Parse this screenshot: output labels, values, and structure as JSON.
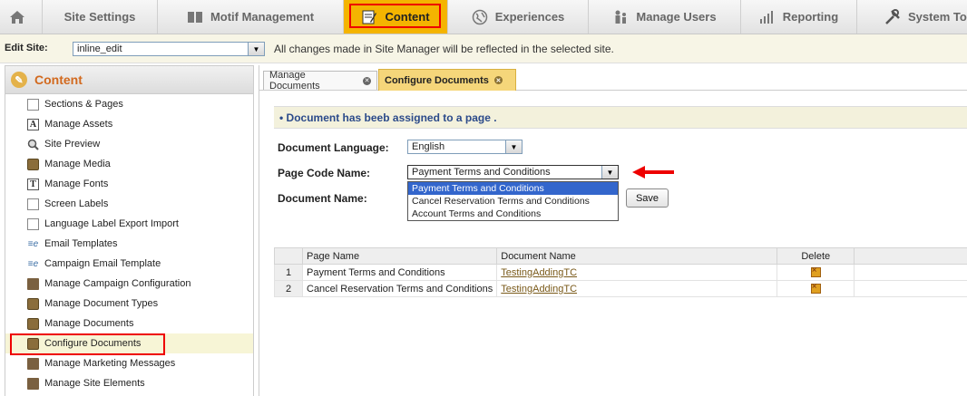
{
  "nav": {
    "items": [
      {
        "key": "home",
        "label": ""
      },
      {
        "key": "site",
        "label": "Site Settings"
      },
      {
        "key": "motif",
        "label": "Motif Management"
      },
      {
        "key": "content",
        "label": "Content"
      },
      {
        "key": "experiences",
        "label": "Experiences"
      },
      {
        "key": "users",
        "label": "Manage Users"
      },
      {
        "key": "reporting",
        "label": "Reporting"
      },
      {
        "key": "system",
        "label": "System To"
      }
    ],
    "active": "content"
  },
  "edit_site": {
    "label": "Edit Site:",
    "value": "inline_edit",
    "note": "All changes made in Site Manager will be reflected in the selected site."
  },
  "sidebar": {
    "title": "Content",
    "items": [
      {
        "label": "Sections & Pages",
        "icon": "page-icon"
      },
      {
        "label": "Manage Assets",
        "icon": "assets-icon"
      },
      {
        "label": "Site Preview",
        "icon": "magnifier-icon"
      },
      {
        "label": "Manage Media",
        "icon": "media-icon"
      },
      {
        "label": "Manage Fonts",
        "icon": "font-icon"
      },
      {
        "label": "Screen Labels",
        "icon": "page-icon"
      },
      {
        "label": "Language Label Export Import",
        "icon": "page-icon"
      },
      {
        "label": "Email Templates",
        "icon": "email-template-icon"
      },
      {
        "label": "Campaign Email Template",
        "icon": "email-template-icon"
      },
      {
        "label": "Manage Campaign Configuration",
        "icon": "document-icon"
      },
      {
        "label": "Manage Document Types",
        "icon": "document-icon"
      },
      {
        "label": "Manage Documents",
        "icon": "document-icon"
      },
      {
        "label": "Configure Documents",
        "icon": "document-icon"
      },
      {
        "label": "Manage Marketing Messages",
        "icon": "document-icon"
      },
      {
        "label": "Manage Site Elements",
        "icon": "document-icon"
      }
    ],
    "active_index": 12
  },
  "tabs": [
    {
      "label": "Manage Documents"
    },
    {
      "label": "Configure Documents"
    }
  ],
  "message": "• Document has beeb assigned to a page .",
  "form": {
    "language_label": "Document Language:",
    "language_value": "English",
    "page_code_label": "Page Code Name:",
    "page_code_value": "Payment Terms and Conditions",
    "page_code_options": [
      "Payment Terms and Conditions",
      "Cancel Reservation Terms and Conditions",
      "Account Terms and Conditions"
    ],
    "document_name_label": "Document Name:",
    "save_label": "Save"
  },
  "table": {
    "headers": [
      "",
      "Page Name",
      "Document Name",
      "Delete"
    ],
    "rows": [
      {
        "num": "1",
        "page": "Payment Terms and Conditions",
        "doc": "TestingAddingTC"
      },
      {
        "num": "2",
        "page": "Cancel Reservation Terms and Conditions",
        "doc": "TestingAddingTC"
      }
    ]
  },
  "colors": {
    "accent": "#f4b400",
    "highlight_border": "#ee0000",
    "message_text": "#2b4a8a",
    "dropdown_selected": "#3366cc"
  }
}
